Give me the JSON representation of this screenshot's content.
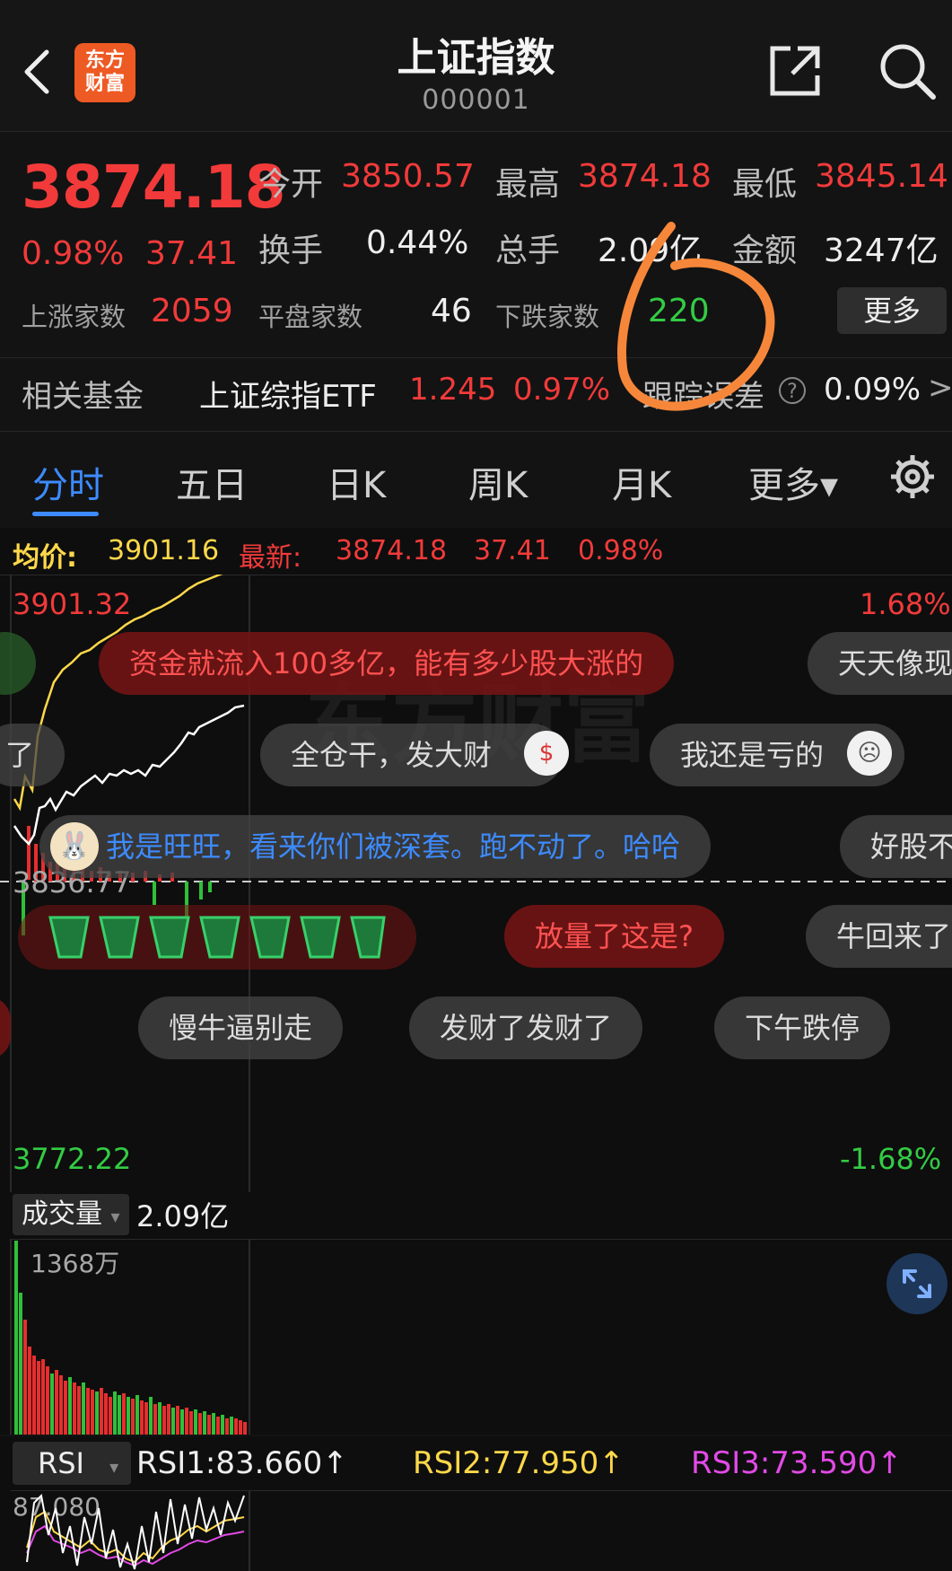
{
  "header": {
    "title": "上证指数",
    "code": "000001",
    "logo_line1": "东方",
    "logo_line2": "财富"
  },
  "quote": {
    "price": "3874.18",
    "change_pct": "0.98%",
    "change": "37.41",
    "open_label": "今开",
    "open": "3850.57",
    "high_label": "最高",
    "high": "3874.18",
    "low_label": "最低",
    "low": "3845.14",
    "turnover_label": "换手",
    "turnover": "0.44%",
    "volume_label": "总手",
    "volume": "2.09亿",
    "amount_label": "金额",
    "amount": "3247亿",
    "up_label": "上涨家数",
    "up": "2059",
    "flat_label": "平盘家数",
    "flat": "46",
    "down_label": "下跌家数",
    "down": "220",
    "more": "更多"
  },
  "fund": {
    "label": "相关基金",
    "name": "上证综指ETF",
    "price": "1.245",
    "pct": "0.97%",
    "track_label": "跟踪误差",
    "track_value": "0.09%",
    "arrow": ">"
  },
  "tabs": [
    {
      "label": "分时",
      "active": true
    },
    {
      "label": "五日"
    },
    {
      "label": "日K"
    },
    {
      "label": "周K"
    },
    {
      "label": "月K"
    },
    {
      "label": "更多▾"
    }
  ],
  "chart": {
    "avg_label": "均价:",
    "avg": "3901.16",
    "latest_label": "最新:",
    "latest": "3874.18",
    "latest_chg": "37.41",
    "latest_pct": "0.98%",
    "y_top": "3901.32",
    "y_top_pct": "1.68%",
    "y_mid": "3836.77",
    "y_bottom": "3772.22",
    "y_bottom_pct": "-1.68%",
    "watermark": "东方财富",
    "colors": {
      "price_line": "#ffffff",
      "avg_line": "#ffd84a",
      "up": "#e62e2e",
      "down": "#2fc03a"
    }
  },
  "danmu": [
    {
      "text": "资金就流入100多亿，能有多少股大涨的",
      "style": "red"
    },
    {
      "text": "天天像现"
    },
    {
      "text": "了"
    },
    {
      "text": "全仓干，发大财"
    },
    {
      "text": "我还是亏的"
    },
    {
      "text": "我是旺旺，看来你们被深套。跑不动了。哈哈",
      "style": "blue"
    },
    {
      "text": "好股不"
    },
    {
      "text": "放量了这是?",
      "style": "red"
    },
    {
      "text": "牛回来了"
    },
    {
      "text": "慢牛逼别走"
    },
    {
      "text": "发财了发财了"
    },
    {
      "text": "下午跌停"
    }
  ],
  "volume": {
    "label": "成交量",
    "value": "2.09亿",
    "max": "1368万"
  },
  "rsi": {
    "label": "RSI",
    "rsi1": "RSI1:83.660↑",
    "rsi2": "RSI2:77.950↑",
    "rsi3": "RSI3:73.590↑",
    "top": "87.080",
    "colors": {
      "rsi1": "#ffffff",
      "rsi2": "#ffd84a",
      "rsi3": "#e24ae6"
    }
  },
  "annotation": {
    "mark": "hand-drawn orange circle around the 220 figure",
    "color": "#f6873a"
  }
}
